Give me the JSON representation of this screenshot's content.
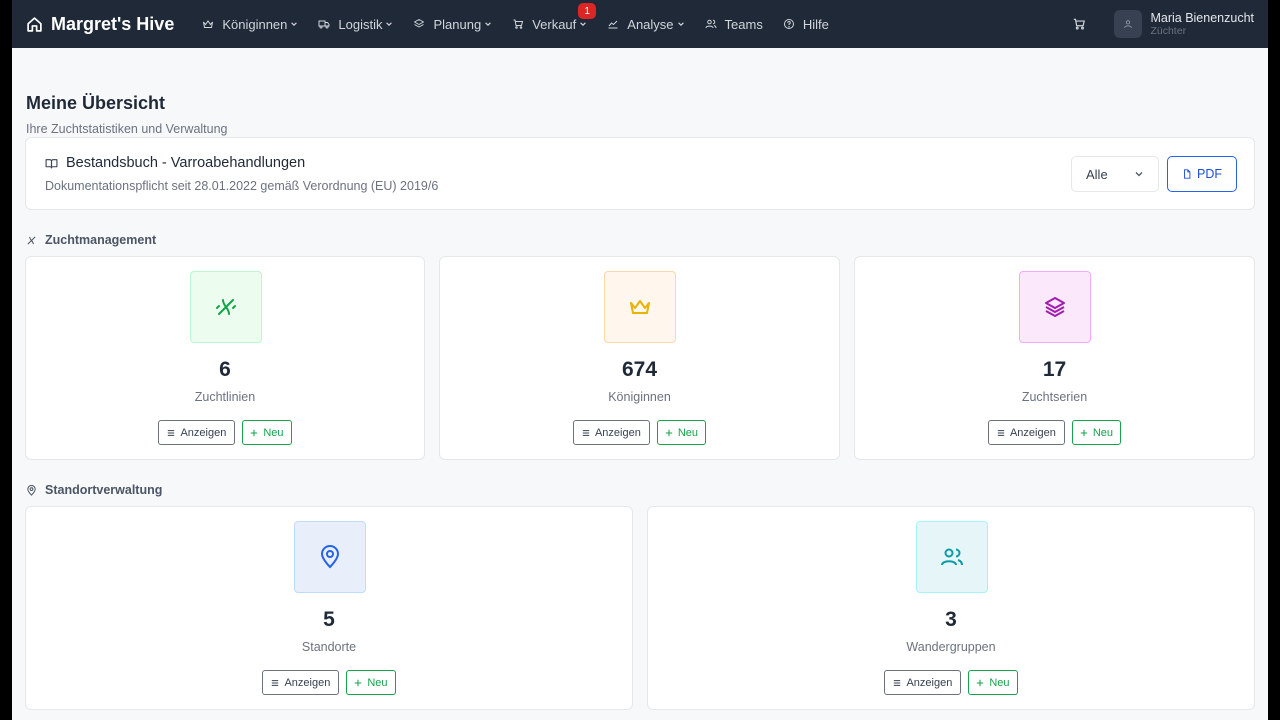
{
  "navbar": {
    "brand": "Margret's Hive",
    "items": [
      {
        "label": "Königinnen",
        "icon": "crown-icon",
        "dropdown": true
      },
      {
        "label": "Logistik",
        "icon": "truck-icon",
        "dropdown": true
      },
      {
        "label": "Planung",
        "icon": "layers-icon",
        "dropdown": true
      },
      {
        "label": "Verkauf",
        "icon": "cart-icon",
        "dropdown": true,
        "badge": "1"
      },
      {
        "label": "Analyse",
        "icon": "chart-icon",
        "dropdown": true
      },
      {
        "label": "Teams",
        "icon": "users-icon",
        "dropdown": false
      },
      {
        "label": "Hilfe",
        "icon": "help-icon",
        "dropdown": false
      }
    ],
    "user": {
      "name": "Maria Bienenzucht",
      "role": "Züchter"
    }
  },
  "page": {
    "title": "Meine Übersicht",
    "subtitle": "Ihre Zuchtstatistiken und Verwaltung"
  },
  "bestandsbuch": {
    "title": "Bestandsbuch - Varroabehandlungen",
    "subtitle": "Dokumentationspflicht seit 28.01.2022 gemäß Verordnung (EU) 2019/6",
    "filter_value": "Alle",
    "pdf_label": "PDF"
  },
  "zuchtmanagement": {
    "label": "Zuchtmanagement",
    "cards": [
      {
        "value": "6",
        "label": "Zuchtlinien",
        "icon": "dna-icon",
        "color": "#16a34a",
        "bg": "#ecfdf0"
      },
      {
        "value": "674",
        "label": "Königinnen",
        "icon": "crown-icon",
        "color": "#eab308",
        "bg": "#fff7ed"
      },
      {
        "value": "17",
        "label": "Zuchtserien",
        "icon": "layers-icon",
        "color": "#a21caf",
        "bg": "#fbe8fb"
      }
    ]
  },
  "standortverwaltung": {
    "label": "Standortverwaltung",
    "cards": [
      {
        "value": "5",
        "label": "Standorte",
        "icon": "map-pin-icon",
        "color": "#2563eb",
        "bg": "#e8eefa"
      },
      {
        "value": "3",
        "label": "Wandergruppen",
        "icon": "users-icon",
        "color": "#0e9ba8",
        "bg": "#e6f5f8"
      }
    ]
  },
  "buttons": {
    "show": "Anzeigen",
    "new": "Neu"
  }
}
